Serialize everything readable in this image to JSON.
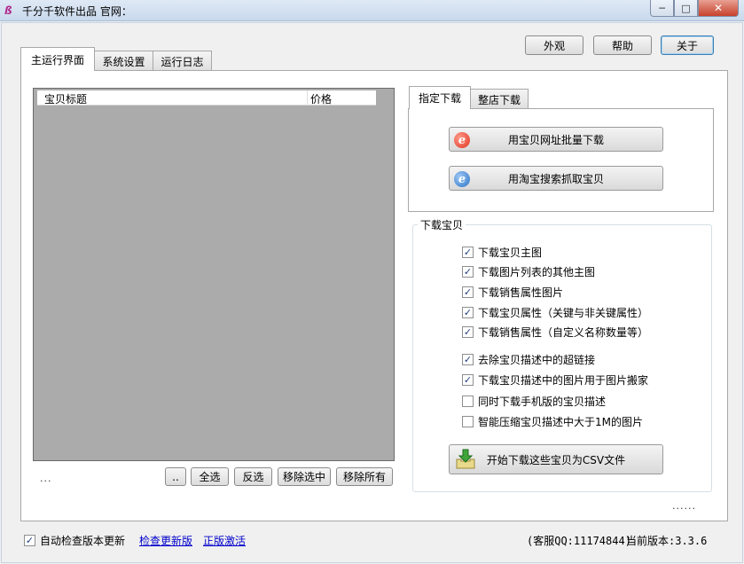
{
  "window": {
    "title": "千分千软件出品 官网：",
    "minimize_glyph": "─",
    "maximize_glyph": "□",
    "close_glyph": "✕"
  },
  "top_buttons": {
    "skin": "外观",
    "help": "帮助",
    "about": "关于"
  },
  "tabs": [
    {
      "label": "主运行界面",
      "active": true
    },
    {
      "label": "系统设置",
      "active": false
    },
    {
      "label": "运行日志",
      "active": false
    }
  ],
  "item_list": {
    "columns": [
      "宝贝标题",
      "价格"
    ]
  },
  "list_buttons": {
    "more": "..",
    "select_all": "全选",
    "invert": "反选",
    "remove_selected": "移除选中",
    "remove_all": "移除所有"
  },
  "list_status": "...",
  "sub_tabs": [
    {
      "label": "指定下载",
      "active": true
    },
    {
      "label": "整店下载",
      "active": false
    }
  ],
  "download_buttons": {
    "by_url": "用宝贝网址批量下载",
    "by_search": "用淘宝搜索抓取宝贝"
  },
  "download_group": {
    "title": "下载宝贝",
    "options": [
      {
        "label": "下载宝贝主图",
        "checked": true
      },
      {
        "label": "下载图片列表的其他主图",
        "checked": true
      },
      {
        "label": "下载销售属性图片",
        "checked": true
      },
      {
        "label": "下载宝贝属性（关键与非关键属性）",
        "checked": true
      },
      {
        "label": "下载销售属性（自定义名称数量等）",
        "checked": true
      },
      {
        "label": "去除宝贝描述中的超链接",
        "checked": true
      },
      {
        "label": "下载宝贝描述中的图片用于图片搬家",
        "checked": true
      },
      {
        "label": "同时下载手机版的宝贝描述",
        "checked": false
      },
      {
        "label": "智能压缩宝贝描述中大于1M的图片",
        "checked": false
      }
    ],
    "start_button": "开始下载这些宝贝为CSV文件"
  },
  "panel_dots": "......",
  "footer": {
    "auto_check_label": "自动检查版本更新",
    "auto_check_checked": true,
    "check_update_link": "检查更新版",
    "activate_link": "正版激活",
    "support": "(客服QQ:11174844)",
    "version": "当前版本:3.3.6"
  },
  "colors": {
    "accent": "#3c7fb1",
    "link": "#0000cc",
    "list_background": "#ababab",
    "close_button": "#c7412c"
  }
}
